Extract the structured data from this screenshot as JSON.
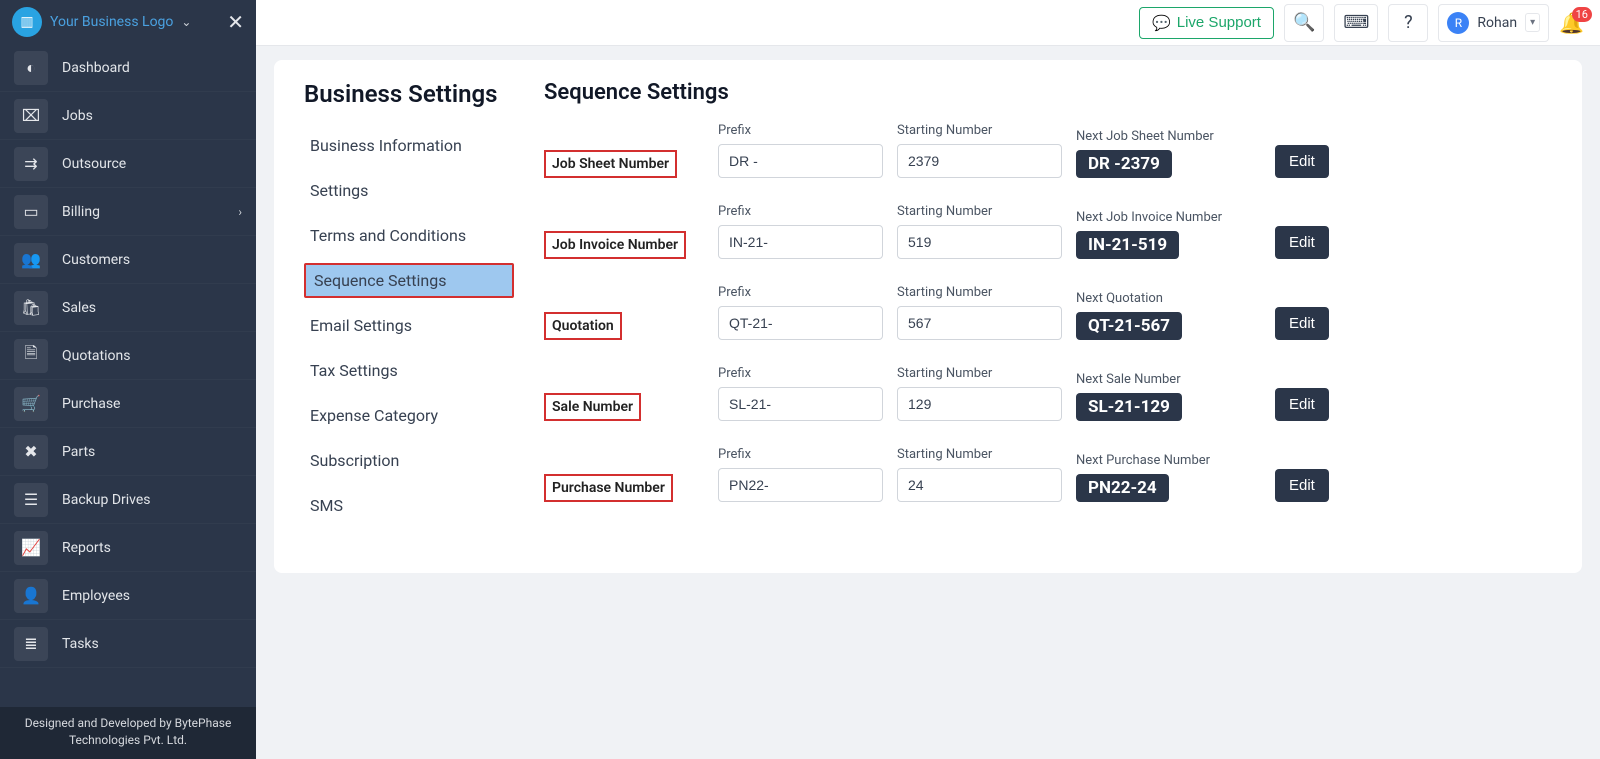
{
  "logo_text": "Your Business Logo",
  "sidebar": [
    {
      "icon": "◐",
      "label": "Dashboard"
    },
    {
      "icon": "⌧",
      "label": "Jobs"
    },
    {
      "icon": "⇉",
      "label": "Outsource"
    },
    {
      "icon": "▭",
      "label": "Billing",
      "expandable": true
    },
    {
      "icon": "👥",
      "label": "Customers"
    },
    {
      "icon": "🛍",
      "label": "Sales"
    },
    {
      "icon": "🗎",
      "label": "Quotations"
    },
    {
      "icon": "🛒",
      "label": "Purchase"
    },
    {
      "icon": "✖",
      "label": "Parts"
    },
    {
      "icon": "☰",
      "label": "Backup Drives"
    },
    {
      "icon": "📈",
      "label": "Reports"
    },
    {
      "icon": "👤",
      "label": "Employees"
    },
    {
      "icon": "≣",
      "label": "Tasks"
    }
  ],
  "footer_line1": "Designed and Developed by BytePhase",
  "footer_line2": "Technologies Pvt. Ltd.",
  "header": {
    "live_support": "Live Support",
    "user_name": "Rohan",
    "user_initial": "R",
    "notif_count": "16"
  },
  "left_title": "Business Settings",
  "subnav": [
    {
      "label": "Business Information"
    },
    {
      "label": "Settings"
    },
    {
      "label": "Terms and Conditions"
    },
    {
      "label": "Sequence Settings",
      "active": true
    },
    {
      "label": "Email Settings"
    },
    {
      "label": "Tax Settings"
    },
    {
      "label": "Expense Category"
    },
    {
      "label": "Subscription"
    },
    {
      "label": "SMS"
    }
  ],
  "right_title": "Sequence Settings",
  "col_prefix": "Prefix",
  "col_start": "Starting Number",
  "edit_label": "Edit",
  "rows": [
    {
      "name": "Job Sheet Number",
      "prefix": "DR -",
      "start": "2379",
      "next_label": "Next Job Sheet Number",
      "next": "DR -2379"
    },
    {
      "name": "Job Invoice Number",
      "prefix": "IN-21-",
      "start": "519",
      "next_label": "Next Job Invoice Number",
      "next": "IN-21-519"
    },
    {
      "name": "Quotation",
      "prefix": "QT-21-",
      "start": "567",
      "next_label": "Next Quotation",
      "next": "QT-21-567"
    },
    {
      "name": "Sale Number",
      "prefix": "SL-21-",
      "start": "129",
      "next_label": "Next Sale Number",
      "next": "SL-21-129"
    },
    {
      "name": "Purchase Number",
      "prefix": "PN22-",
      "start": "24",
      "next_label": "Next Purchase Number",
      "next": "PN22-24"
    }
  ]
}
